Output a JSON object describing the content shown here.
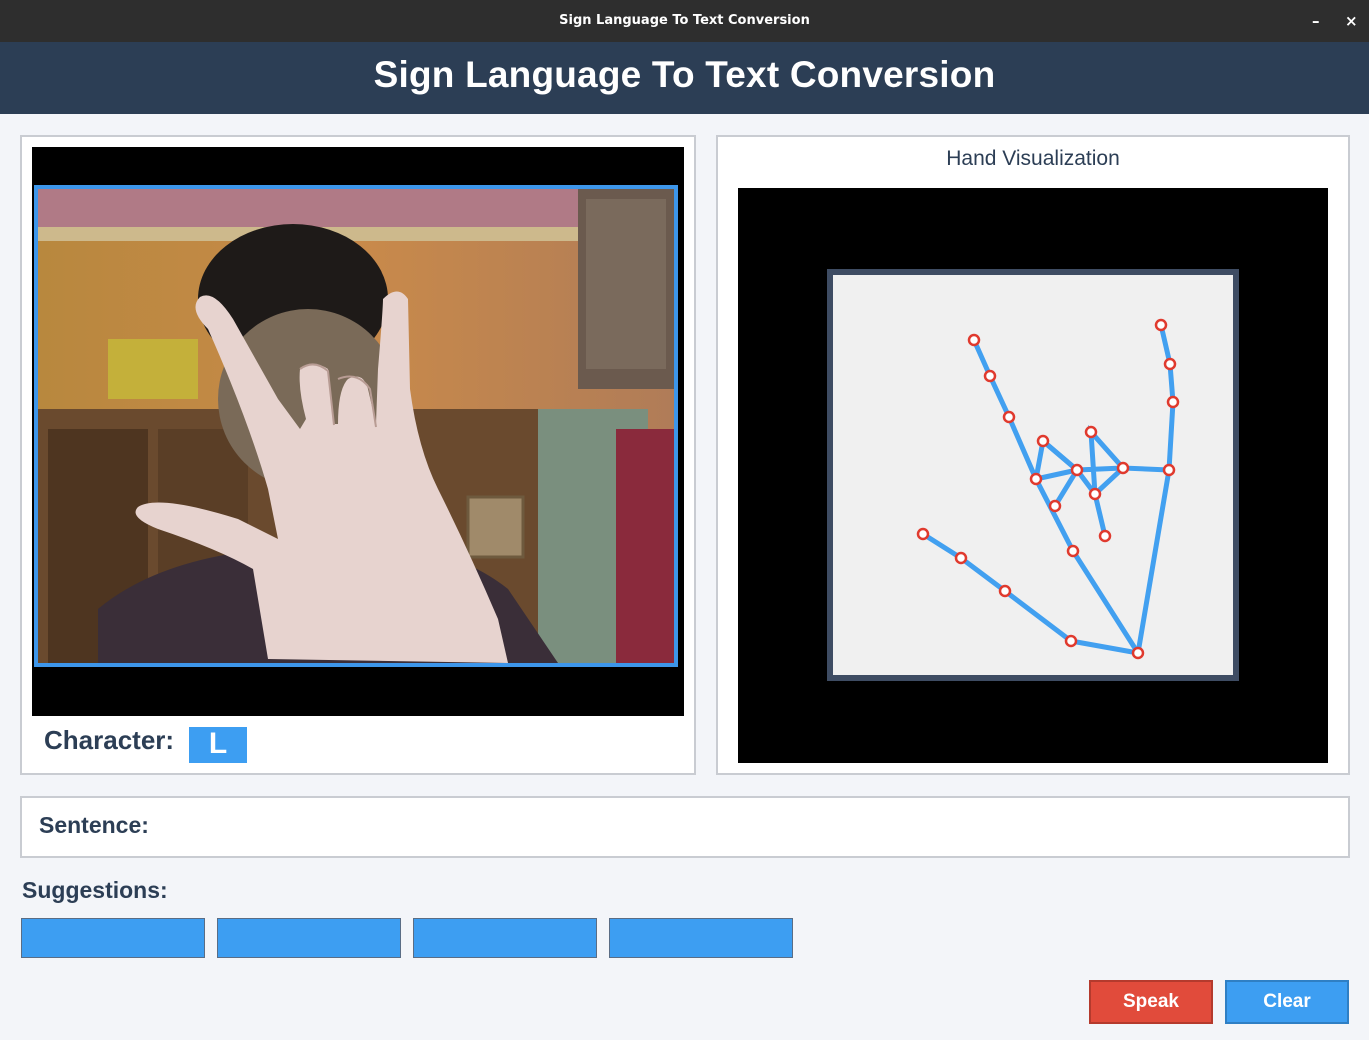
{
  "window": {
    "title": "Sign Language To Text Conversion",
    "minimize_glyph": "–",
    "close_glyph": "×"
  },
  "header": {
    "title": "Sign Language To Text Conversion"
  },
  "camera": {
    "character_label": "Character:",
    "character_value": "L"
  },
  "visualization": {
    "title": "Hand Visualization"
  },
  "sentence": {
    "label": "Sentence:",
    "value": ""
  },
  "suggestions": {
    "label": "Suggestions:",
    "items": [
      "",
      "",
      "",
      ""
    ]
  },
  "actions": {
    "speak_label": "Speak",
    "clear_label": "Clear"
  },
  "colors": {
    "header_bg": "#2c3e55",
    "accent_blue": "#3d9ef2",
    "speak_red": "#e14b3b",
    "landmark_red": "#e03a2e",
    "skeleton_blue": "#42a0f0"
  }
}
